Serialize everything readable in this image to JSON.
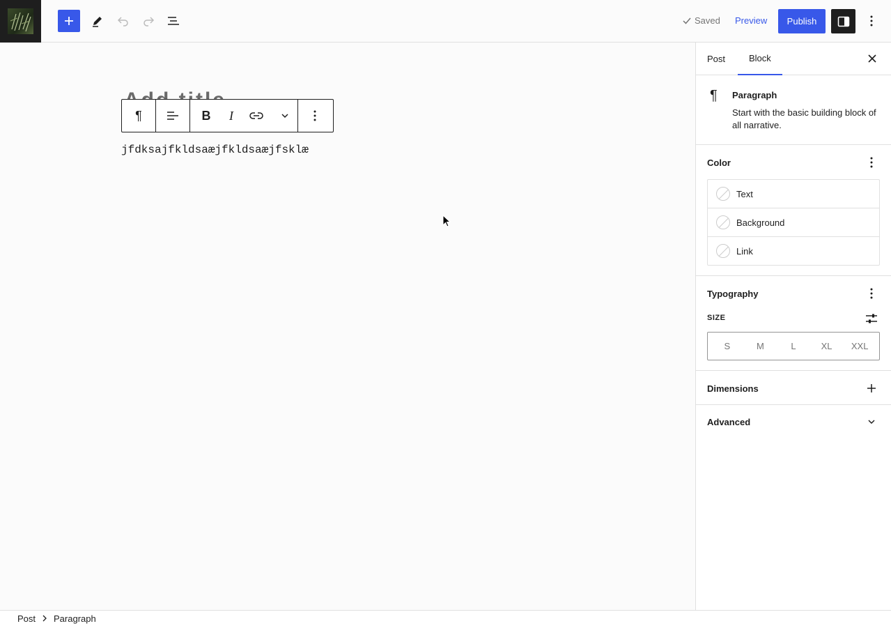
{
  "topbar": {
    "saved_label": "Saved",
    "preview_label": "Preview",
    "publish_label": "Publish"
  },
  "editor": {
    "title_peek": "Add title",
    "paragraph_text": "jfdksajfkldsaæjfkldsaæjfsklæ"
  },
  "sidebar": {
    "tabs": [
      {
        "label": "Post"
      },
      {
        "label": "Block"
      }
    ],
    "block": {
      "name": "Paragraph",
      "description": "Start with the basic building block of all narrative."
    },
    "color": {
      "title": "Color",
      "items": [
        {
          "label": "Text"
        },
        {
          "label": "Background"
        },
        {
          "label": "Link"
        }
      ]
    },
    "typography": {
      "title": "Typography",
      "size_label": "SIZE",
      "sizes": [
        "S",
        "M",
        "L",
        "XL",
        "XXL"
      ]
    },
    "dimensions": {
      "title": "Dimensions"
    },
    "advanced": {
      "title": "Advanced"
    }
  },
  "footer": {
    "breadcrumb": [
      "Post",
      "Paragraph"
    ]
  },
  "colors": {
    "accent": "#3858e9",
    "dark": "#1e1e1e",
    "muted": "#757575"
  }
}
